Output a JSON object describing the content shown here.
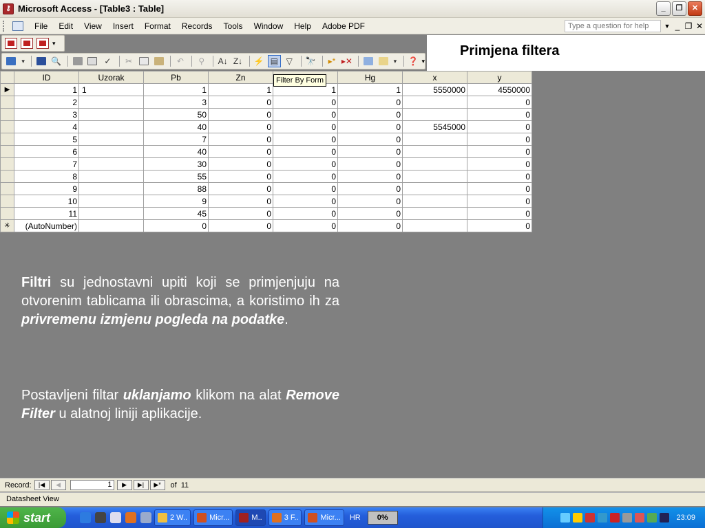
{
  "window": {
    "title": "Microsoft Access - [Table3 : Table]"
  },
  "menu": {
    "items": [
      "File",
      "Edit",
      "View",
      "Insert",
      "Format",
      "Records",
      "Tools",
      "Window",
      "Help",
      "Adobe PDF"
    ],
    "help_placeholder": "Type a question for help"
  },
  "slide": {
    "title": "Primjena filtera"
  },
  "tooltip": "Filter By Form",
  "table": {
    "columns": [
      "ID",
      "Uzorak",
      "Pb",
      "Zn",
      "",
      "Hg",
      "x",
      "y"
    ],
    "rows": [
      [
        "1",
        "1",
        "1",
        "1",
        "1",
        "1",
        "5550000",
        "4550000"
      ],
      [
        "2",
        "",
        "3",
        "0",
        "0",
        "0",
        "",
        "0"
      ],
      [
        "3",
        "",
        "50",
        "0",
        "0",
        "0",
        "",
        "0"
      ],
      [
        "4",
        "",
        "40",
        "0",
        "0",
        "0",
        "5545000",
        "0"
      ],
      [
        "5",
        "",
        "7",
        "0",
        "0",
        "0",
        "",
        "0"
      ],
      [
        "6",
        "",
        "40",
        "0",
        "0",
        "0",
        "",
        "0"
      ],
      [
        "7",
        "",
        "30",
        "0",
        "0",
        "0",
        "",
        "0"
      ],
      [
        "8",
        "",
        "55",
        "0",
        "0",
        "0",
        "",
        "0"
      ],
      [
        "9",
        "",
        "88",
        "0",
        "0",
        "0",
        "",
        "0"
      ],
      [
        "10",
        "",
        "9",
        "0",
        "0",
        "0",
        "",
        "0"
      ],
      [
        "11",
        "",
        "45",
        "0",
        "0",
        "0",
        "",
        "0"
      ],
      [
        "(AutoNumber)",
        "",
        "0",
        "0",
        "0",
        "0",
        "",
        "0"
      ]
    ]
  },
  "text1": {
    "a": "Filtri",
    "b": " su jednostavni upiti koji se primjenjuju na otvorenim tablicama ili obrascima, a koristimo ih za ",
    "c": "privremenu izmjenu pogleda na podatke",
    "d": "."
  },
  "text2": {
    "a": "Postavljeni filtar ",
    "b": "uklanjamo",
    "c": " klikom na alat ",
    "d": "Remove Filter",
    "e": " u alatnoj liniji aplikacije."
  },
  "navigator": {
    "label": "Record:",
    "current": "1",
    "of": "of",
    "total": "11"
  },
  "status": "Datasheet View",
  "taskbar": {
    "start": "start",
    "tasks": [
      "2 W..",
      "Micr...",
      "M..",
      "3 F..",
      "Micr..."
    ],
    "lang": "HR",
    "cpu": "0%",
    "clock": "23:09"
  }
}
